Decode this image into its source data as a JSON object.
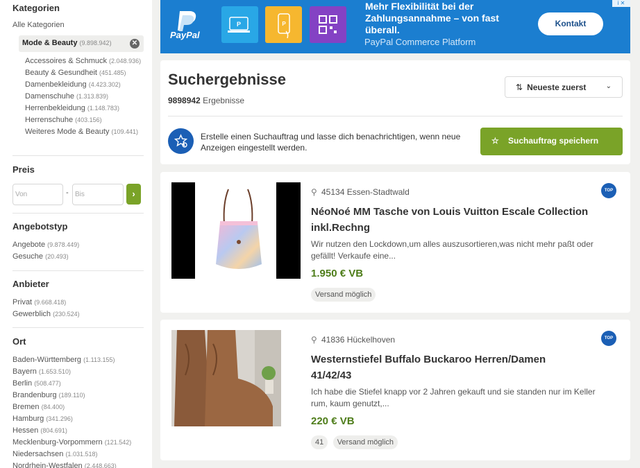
{
  "sidebar": {
    "categories": {
      "title": "Kategorien",
      "all_label": "Alle Kategorien",
      "selected": {
        "label": "Mode & Beauty",
        "count": "(9.898.942)"
      },
      "subcategories": [
        {
          "label": "Accessoires & Schmuck",
          "count": "(2.048.936)"
        },
        {
          "label": "Beauty & Gesundheit",
          "count": "(451.485)"
        },
        {
          "label": "Damenbekleidung",
          "count": "(4.423.302)"
        },
        {
          "label": "Damenschuhe",
          "count": "(1.313.839)"
        },
        {
          "label": "Herrenbekleidung",
          "count": "(1.148.783)"
        },
        {
          "label": "Herrenschuhe",
          "count": "(403.156)"
        },
        {
          "label": "Weiteres Mode & Beauty",
          "count": "(109.441)"
        }
      ]
    },
    "price": {
      "title": "Preis",
      "from_placeholder": "Von",
      "dash": "-",
      "to_placeholder": "Bis",
      "go_icon": "chevron-right-icon"
    },
    "offer_type": {
      "title": "Angebotstyp",
      "items": [
        {
          "label": "Angebote",
          "count": "(9.878.449)"
        },
        {
          "label": "Gesuche",
          "count": "(20.493)"
        }
      ]
    },
    "provider": {
      "title": "Anbieter",
      "items": [
        {
          "label": "Privat",
          "count": "(9.668.418)"
        },
        {
          "label": "Gewerblich",
          "count": "(230.524)"
        }
      ]
    },
    "location": {
      "title": "Ort",
      "items": [
        {
          "label": "Baden-Württemberg",
          "count": "(1.113.155)"
        },
        {
          "label": "Bayern",
          "count": "(1.653.510)"
        },
        {
          "label": "Berlin",
          "count": "(508.477)"
        },
        {
          "label": "Brandenburg",
          "count": "(189.110)"
        },
        {
          "label": "Bremen",
          "count": "(84.400)"
        },
        {
          "label": "Hamburg",
          "count": "(341.296)"
        },
        {
          "label": "Hessen",
          "count": "(804.691)"
        },
        {
          "label": "Mecklenburg-Vorpommern",
          "count": "(121.542)"
        },
        {
          "label": "Niedersachsen",
          "count": "(1.031.518)"
        },
        {
          "label": "Nordrhein-Westfalen",
          "count": "(2.448.663)"
        }
      ]
    }
  },
  "ad": {
    "brand": "PayPal",
    "headline": "Mehr Flexibilität bei der Zahlungsannahme – von fast überall.",
    "subline": "PayPal Commerce Platform",
    "cta": "Kontakt",
    "close": "i ✕"
  },
  "results": {
    "title": "Suchergebnisse",
    "count_value": "9898942",
    "count_label": "Ergebnisse",
    "sort_label": "Neueste zuerst",
    "alert_text": "Erstelle einen Suchauftrag und lasse dich benachrichtigen, wenn neue Anzeigen eingestellt werden.",
    "save_search_label": "Suchauftrag speichern"
  },
  "listings": [
    {
      "location": "45134 Essen-Stadtwald",
      "badge": "TOP",
      "title": "NéoNoé MM Tasche von Louis Vuitton Escale Collection inkl.Rechng",
      "description": "Wir nutzen den Lockdown,um alles auszusortieren,was nicht mehr paßt oder gefällt! Verkaufe eine...",
      "price": "1.950 € VB",
      "tags": [
        "Versand möglich"
      ]
    },
    {
      "location": "41836 Hückelhoven",
      "badge": "TOP",
      "title": "Westernstiefel Buffalo Buckaroo Herren/Damen 41/42/43",
      "description": "Ich habe die Stiefel knapp vor 2 Jahren gekauft und sie standen nur im Keller rum, kaum genutzt,...",
      "price": "220 € VB",
      "tags": [
        "41",
        "Versand möglich"
      ]
    }
  ],
  "colors": {
    "accent_green": "#7aa328",
    "price_green": "#4e7d1a",
    "brand_blue": "#1b5fb5",
    "ad_blue": "#1b7ed0"
  }
}
